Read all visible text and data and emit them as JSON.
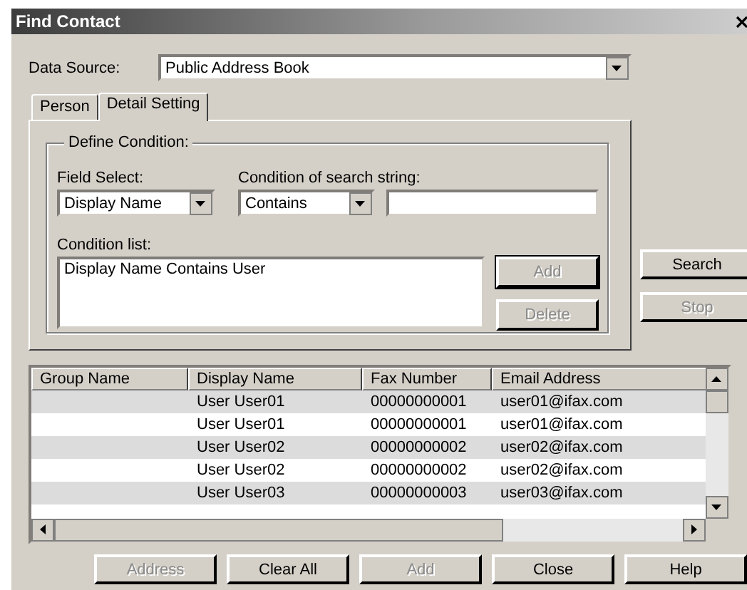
{
  "window": {
    "title": "Find Contact"
  },
  "data_source": {
    "label": "Data Source:",
    "value": "Public Address Book"
  },
  "tabs": [
    {
      "label": "Person",
      "selected": false
    },
    {
      "label": "Detail Setting",
      "selected": true
    }
  ],
  "define_condition": {
    "legend": "Define Condition:",
    "field_select": {
      "label": "Field Select:",
      "value": "Display Name"
    },
    "condition": {
      "label": "Condition of search string:",
      "value": "Contains"
    },
    "condition_list": {
      "label": "Condition list:",
      "items": [
        "Display Name Contains User"
      ]
    },
    "buttons": [
      {
        "label": "Add",
        "disabled": true
      },
      {
        "label": "Delete",
        "disabled": true
      }
    ]
  },
  "side_buttons": [
    {
      "label": "Search",
      "disabled": false
    },
    {
      "label": "Stop",
      "disabled": true
    }
  ],
  "table": {
    "columns": [
      "Group Name",
      "Display Name",
      "Fax Number",
      "Email Address"
    ],
    "rows": [
      [
        "",
        "User User01",
        "00000000001",
        "user01@ifax.com"
      ],
      [
        "",
        "User User01",
        "00000000001",
        "user01@ifax.com"
      ],
      [
        "",
        "User User02",
        "00000000002",
        "user02@ifax.com"
      ],
      [
        "",
        "User User02",
        "00000000002",
        "user02@ifax.com"
      ],
      [
        "",
        "User User03",
        "00000000003",
        "user03@ifax.com"
      ]
    ]
  },
  "bottom_buttons": [
    {
      "label": "Address",
      "disabled": true
    },
    {
      "label": "Clear All",
      "disabled": false
    },
    {
      "label": "Add",
      "disabled": true
    },
    {
      "label": "Close",
      "disabled": false
    },
    {
      "label": "Help",
      "disabled": false
    }
  ]
}
